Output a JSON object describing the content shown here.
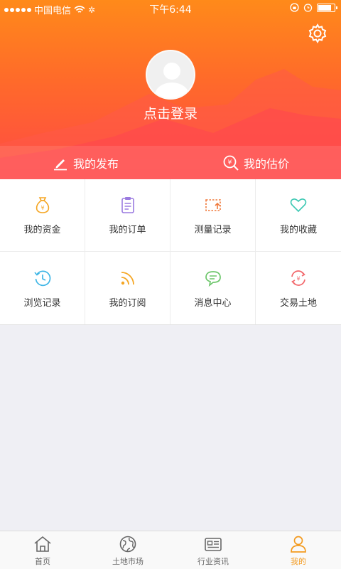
{
  "status_bar": {
    "carrier": "中国电信",
    "time": "下午6:44"
  },
  "profile": {
    "login_text": "点击登录"
  },
  "actions": [
    {
      "label": "我的发布",
      "icon": "edit-icon"
    },
    {
      "label": "我的估价",
      "icon": "valuation-icon"
    }
  ],
  "grid_items": [
    {
      "label": "我的资金",
      "icon": "money-bag-icon",
      "color": "#f5a623"
    },
    {
      "label": "我的订单",
      "icon": "clipboard-icon",
      "color": "#9b7be0"
    },
    {
      "label": "测量记录",
      "icon": "measure-icon",
      "color": "#f07a3c"
    },
    {
      "label": "我的收藏",
      "icon": "heart-icon",
      "color": "#3fc9b4"
    },
    {
      "label": "浏览记录",
      "icon": "history-icon",
      "color": "#3fb6e6"
    },
    {
      "label": "我的订阅",
      "icon": "rss-icon",
      "color": "#f5a623"
    },
    {
      "label": "消息中心",
      "icon": "message-icon",
      "color": "#6cc66a"
    },
    {
      "label": "交易土地",
      "icon": "exchange-icon",
      "color": "#f2666a"
    }
  ],
  "tabs": [
    {
      "label": "首页",
      "icon": "home-icon",
      "active": false
    },
    {
      "label": "土地市场",
      "icon": "globe-icon",
      "active": false
    },
    {
      "label": "行业资讯",
      "icon": "news-icon",
      "active": false
    },
    {
      "label": "我的",
      "icon": "user-icon",
      "active": true
    }
  ],
  "colors": {
    "header_top": "#ff8a1a",
    "header_bottom": "#ff4a45",
    "active_tab": "#f39a1e",
    "background": "#efeff4"
  }
}
